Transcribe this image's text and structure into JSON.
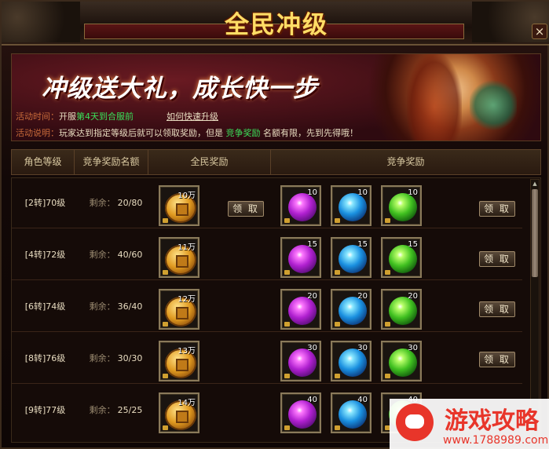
{
  "window": {
    "title": "全民冲级",
    "close_label": "×"
  },
  "banner": {
    "slogan": "冲级送大礼，成长快一步",
    "time_label": "活动时间：",
    "time_prefix": "开服",
    "time_highlight": "第4天到合服前",
    "help_link": "如何快速升级",
    "desc_label": "活动说明：",
    "desc_before": "玩家达到指定等级后就可以领取奖励，但是",
    "desc_highlight": "竞争奖励",
    "desc_after": "名额有限，先到先得哦！"
  },
  "table": {
    "headers": [
      "角色等级",
      "竞争奖励名额",
      "全民奖励",
      "竞争奖励"
    ],
    "remain_label": "剩余：",
    "claim_label": "领 取",
    "rows": [
      {
        "level": "[2转]70级",
        "remain": "20/80",
        "coin": "10万",
        "gems": [
          "10",
          "10",
          "10"
        ]
      },
      {
        "level": "[4转]72级",
        "remain": "40/60",
        "coin": "11万",
        "gems": [
          "15",
          "15",
          "15"
        ]
      },
      {
        "level": "[6转]74级",
        "remain": "36/40",
        "coin": "12万",
        "gems": [
          "20",
          "20",
          "20"
        ]
      },
      {
        "level": "[8转]76级",
        "remain": "30/30",
        "coin": "13万",
        "gems": [
          "30",
          "30",
          "30"
        ]
      },
      {
        "level": "[9转]77级",
        "remain": "25/25",
        "coin": "14万",
        "gems": [
          "40",
          "40",
          "40"
        ]
      }
    ]
  },
  "watermark": {
    "title": "游戏攻略",
    "url": "www.1788989.com"
  },
  "colors": {
    "title_gold": "#ffdd66",
    "label_orange": "#c86a3a",
    "highlight_green": "#3ae05a",
    "watermark_red": "#e8352a"
  },
  "icons": {
    "coin": "gold-coin-icon",
    "gem_purple": "purple-gem-icon",
    "gem_blue": "blue-gem-icon",
    "gem_green": "green-gem-icon"
  }
}
